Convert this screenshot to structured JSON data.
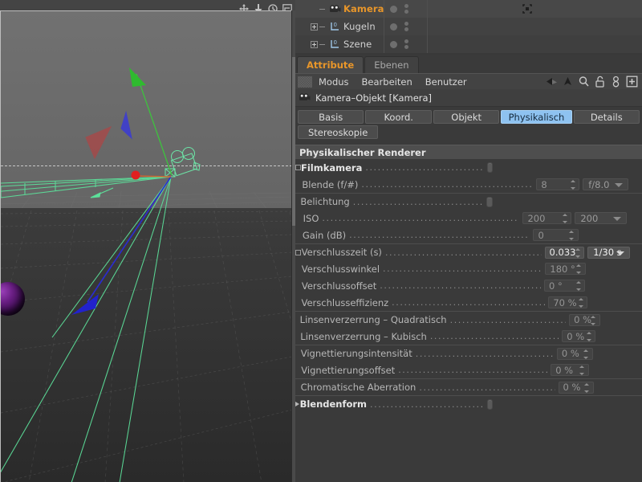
{
  "viewport": {
    "toolbar_icons": [
      "move-axis-icon",
      "scale-down-icon",
      "rotate-icon",
      "maximize-view-icon"
    ],
    "scene_objects": [
      "camera-gizmo",
      "ground-plane",
      "purple-sphere",
      "light-cone-red",
      "light-cone-blue"
    ],
    "axis_colors": {
      "x": "#cc2222",
      "y": "#22bb22",
      "z": "#2222cc",
      "camera_wire": "#5ce09a"
    }
  },
  "object_manager": {
    "rows": [
      {
        "label": "Kamera",
        "icon": "camera-icon",
        "selected": true,
        "expandable": false,
        "tag": "camera-tag-icon"
      },
      {
        "label": "Kugeln",
        "icon": "layer-null-icon",
        "selected": false,
        "expandable": true,
        "tag": ""
      },
      {
        "label": "Szene",
        "icon": "layer-null-icon",
        "selected": false,
        "expandable": true,
        "tag": ""
      }
    ]
  },
  "panel_tabs": [
    {
      "label": "Attribute",
      "active": true
    },
    {
      "label": "Ebenen",
      "active": false
    }
  ],
  "menubar": {
    "items": [
      "Modus",
      "Bearbeiten",
      "Benutzer"
    ],
    "icons": [
      "back-arrow-icon",
      "forward-arrow-icon",
      "up-arrow-icon",
      "search-icon",
      "lock-open-icon",
      "link-icon",
      "add-panel-icon"
    ]
  },
  "object_header": {
    "icon": "camera-icon",
    "title": "Kamera–Objekt [Kamera]"
  },
  "attribute_tabs": [
    {
      "label": "Basis",
      "active": false
    },
    {
      "label": "Koord.",
      "active": false
    },
    {
      "label": "Objekt",
      "active": false
    },
    {
      "label": "Physikalisch",
      "active": true
    },
    {
      "label": "Details",
      "active": false
    },
    {
      "label": "Stereoskopie",
      "active": false
    }
  ],
  "section": {
    "title": "Physikalischer Renderer"
  },
  "parameters": [
    {
      "label": "Filmkamera",
      "lead": "checkbox-square",
      "bold": true,
      "enabled": true,
      "control": "checkbox",
      "checkbox": false,
      "separator": false
    },
    {
      "label": "Blende (f/#)",
      "lead": "none",
      "bold": false,
      "enabled": false,
      "control": "field+select",
      "value": "8",
      "select": "f/8.0",
      "separator": false
    },
    {
      "label": "Belichtung",
      "lead": "none",
      "bold": false,
      "enabled": false,
      "control": "checkbox",
      "checkbox": false,
      "separator": true
    },
    {
      "label": "ISO",
      "lead": "none",
      "bold": false,
      "enabled": false,
      "control": "field+select",
      "value": "200",
      "select": "200",
      "separator": false
    },
    {
      "label": "Gain (dB)",
      "lead": "none",
      "bold": false,
      "enabled": false,
      "control": "field",
      "value": "0",
      "separator": false
    },
    {
      "label": "Verschlusszeit (s)",
      "lead": "checkbox-square",
      "bold": false,
      "enabled": true,
      "control": "field+select",
      "value": "0.033",
      "select": "1/30 s",
      "separator": true
    },
    {
      "label": "Verschlusswinkel",
      "lead": "none",
      "bold": false,
      "enabled": false,
      "control": "field",
      "value": "180 °",
      "separator": false
    },
    {
      "label": "Verschlussoffset",
      "lead": "none",
      "bold": false,
      "enabled": false,
      "control": "field",
      "value": "0 °",
      "separator": false
    },
    {
      "label": "Verschlusseffizienz",
      "lead": "none",
      "bold": false,
      "enabled": false,
      "control": "field",
      "value": "70 %",
      "separator": false
    },
    {
      "label": "Linsenverzerrung – Quadratisch",
      "lead": "none",
      "bold": false,
      "enabled": false,
      "control": "field",
      "value": "0 %",
      "separator": true
    },
    {
      "label": "Linsenverzerrung – Kubisch",
      "lead": "none",
      "bold": false,
      "enabled": false,
      "control": "field",
      "value": "0 %",
      "separator": false
    },
    {
      "label": "Vignettierungsintensität",
      "lead": "none",
      "bold": false,
      "enabled": false,
      "control": "field",
      "value": "0 %",
      "separator": true
    },
    {
      "label": "Vignettierungsoffset",
      "lead": "none",
      "bold": false,
      "enabled": false,
      "control": "field",
      "value": "0 %",
      "separator": false
    },
    {
      "label": "Chromatische Aberration",
      "lead": "none",
      "bold": false,
      "enabled": false,
      "control": "field",
      "value": "0 %",
      "separator": true
    },
    {
      "label": "Blendenform",
      "lead": "triangle",
      "bold": true,
      "enabled": true,
      "control": "checkbox",
      "checkbox": false,
      "separator": true
    }
  ],
  "colors": {
    "panel_bg": "#3a3a3a",
    "accent_orange": "#e8962a",
    "tab_active_blue": "#8ec2f0",
    "section_bar": "#4e4e4e"
  }
}
